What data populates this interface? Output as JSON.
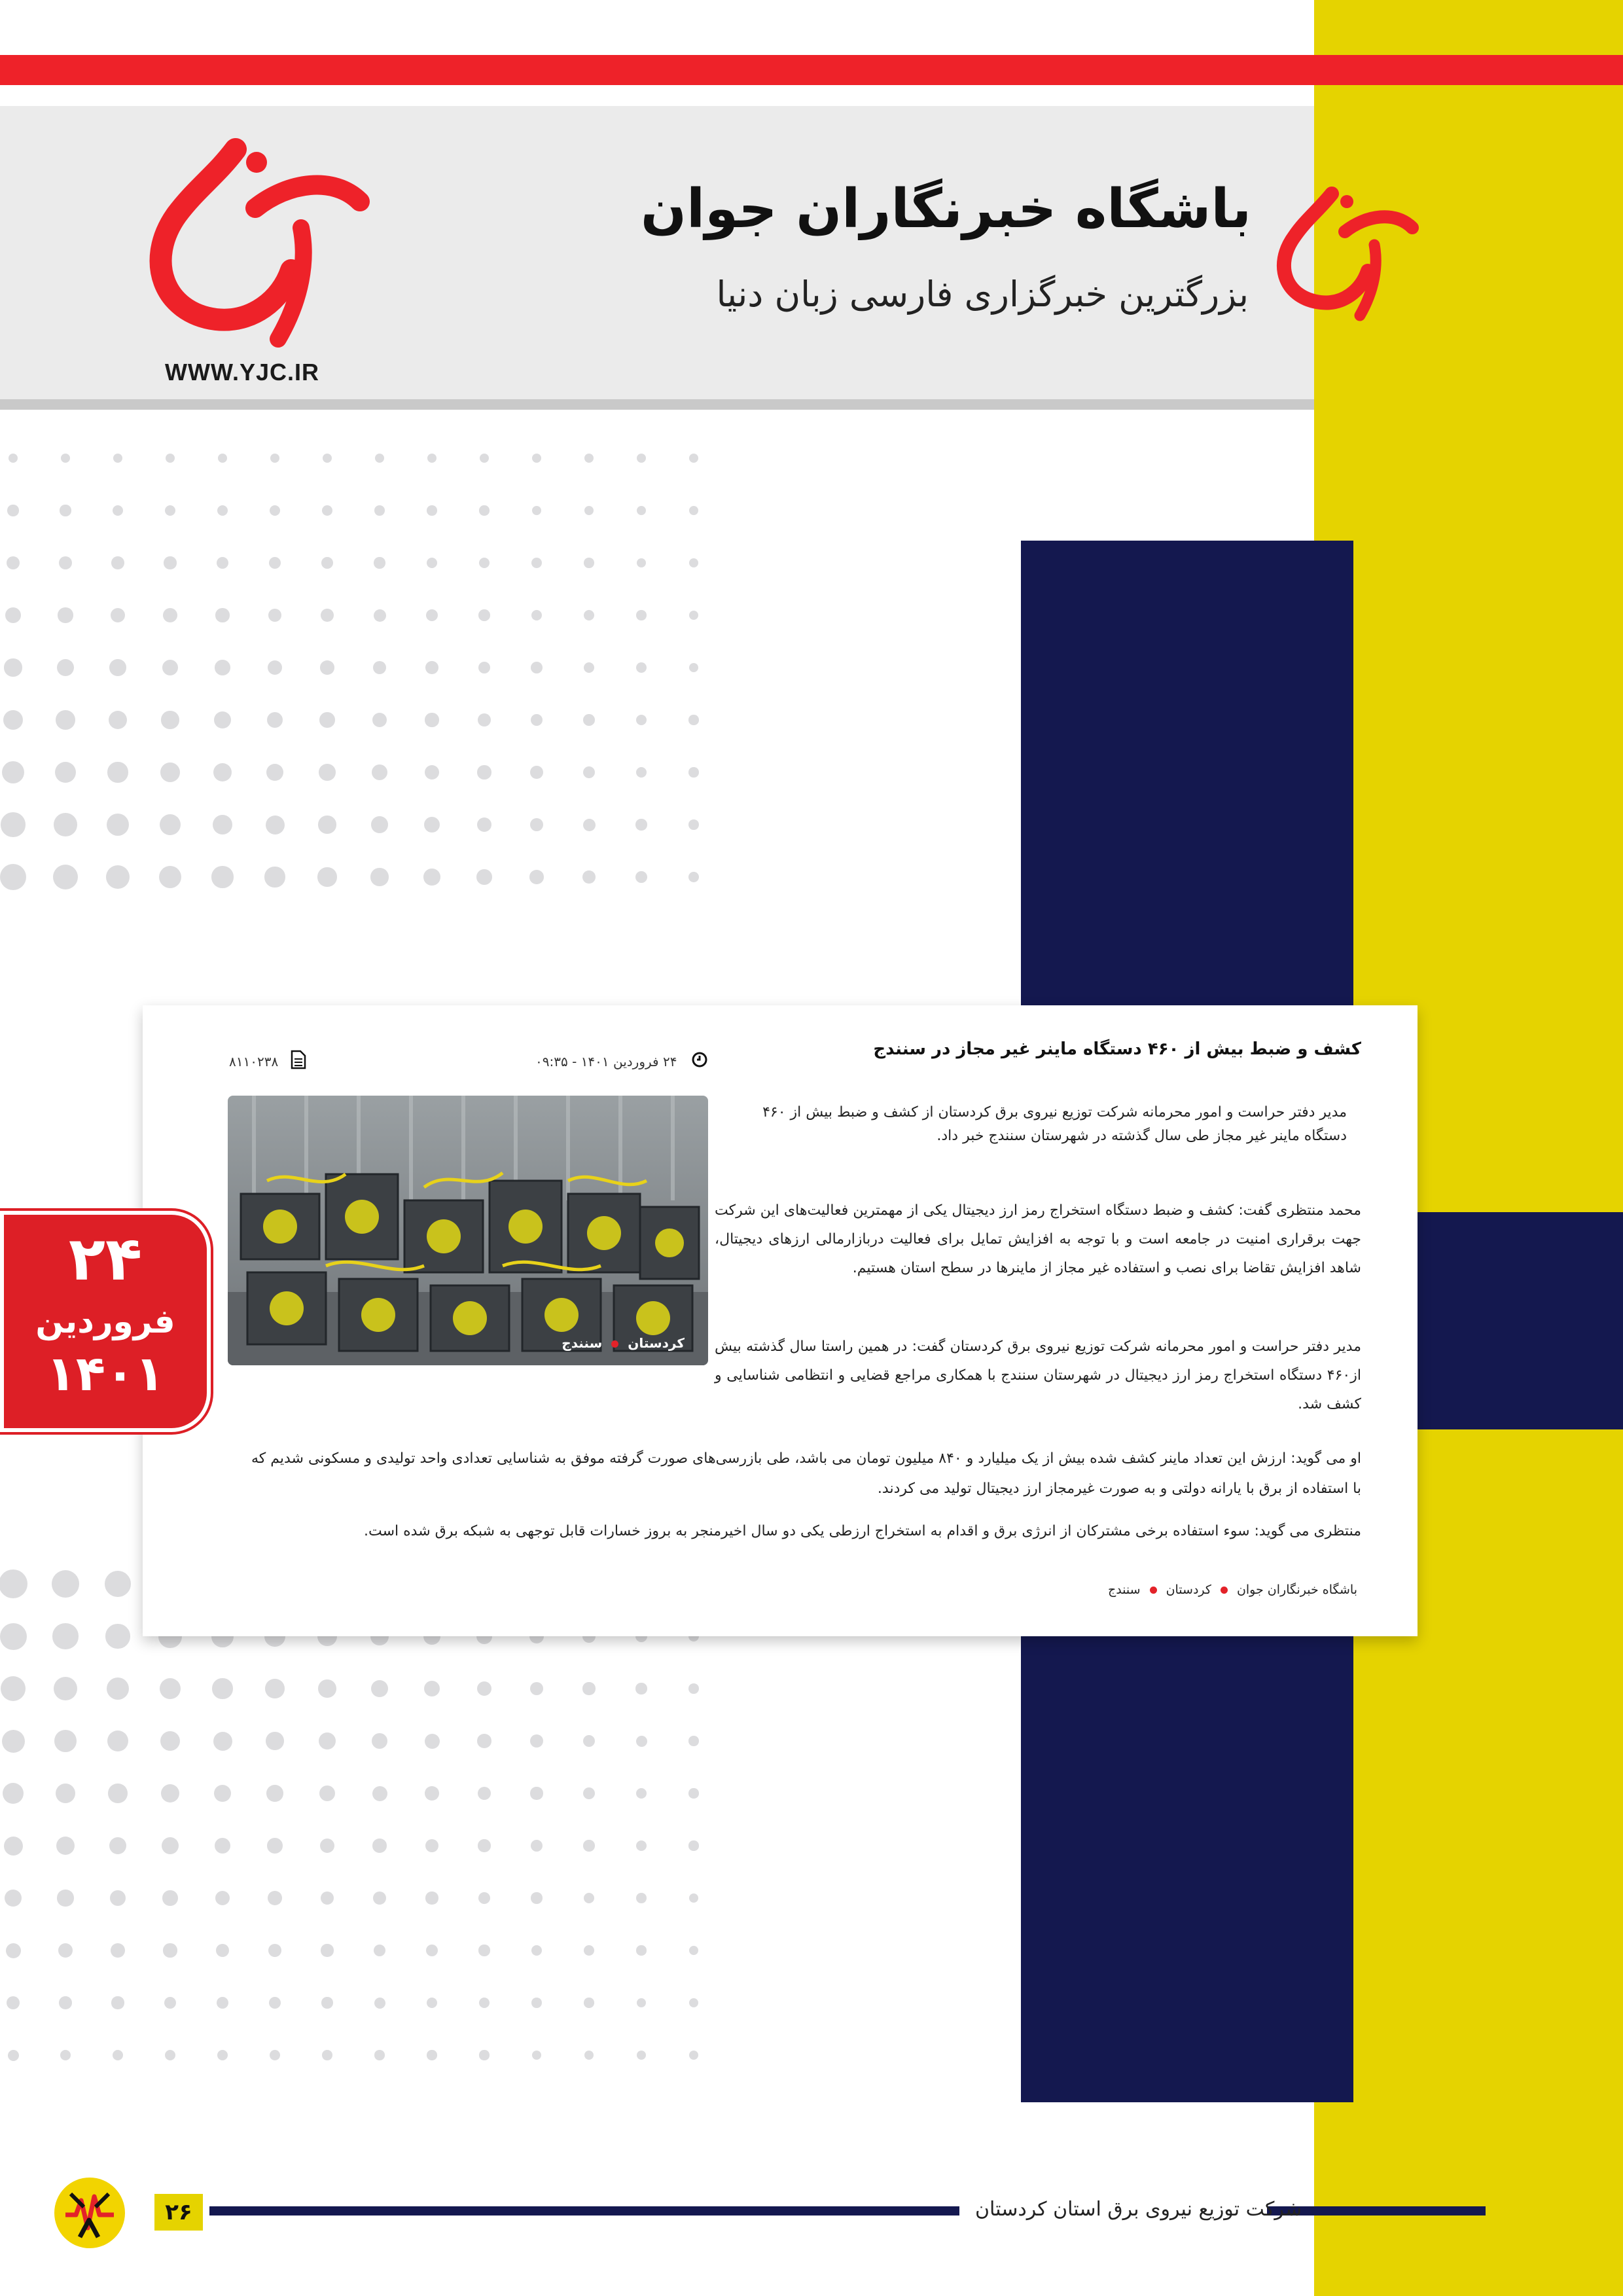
{
  "colors": {
    "red": "#ee2229",
    "yellow": "#e5d300",
    "navy": "#14184f",
    "header_gray": "#ebebeb"
  },
  "header": {
    "logo_icon": "yjc-logo",
    "site_url": "WWW.YJC.IR",
    "brand_title": "باشگاه خبرنگاران جوان",
    "brand_subtitle": "بزرگترین خبرگزاری فارسی زبان دنیا"
  },
  "date_badge": {
    "day": "۲۴",
    "month": "فروردین",
    "year": "۱۴۰۱"
  },
  "article": {
    "title": "کشف و ضبط بیش از ۴۶۰ دستگاه ماینر غیر مجاز در سنندج",
    "date_time": "۲۴ فروردین ۱۴۰۱ - ۰۹:۳۵",
    "news_id": "۸۱۱۰۲۳۸",
    "lead": "مدیر دفتر حراست و امور محرمانه شرکت توزیع نیروی برق کردستان از کشف و ضبط بیش از ۴۶۰ دستگاه ماینر غیر مجاز طی سال گذشته در شهرستان سنندج خبر داد.",
    "photo_tags": [
      "کردستان",
      "سنندج"
    ],
    "paragraphs": [
      "محمد منتظری گفت: کشف و ضبط دستگاه استخراج رمز ارز دیجیتال یکی از مهمترین فعالیت‌های این شرکت جهت برقراری امنیت در جامعه است و با توجه به افزایش تمایل برای فعالیت دربازارمالی ارزهای دیجیتال، شاهد افزایش تقاضا برای نصب و استفاده غیر مجاز از ماینرها در سطح استان هستیم.",
      "مدیر دفتر حراست و امور محرمانه شرکت توزیع نیروی برق کردستان گفت: در همین راستا سال گذشته بیش از۴۶۰ دستگاه استخراج رمز ارز دیجیتال در شهرستان سنندج با همکاری مراجع قضایی و انتظامی شناسایی و کشف شد.",
      "او می گوید: ارزش این تعداد ماینر کشف شده بیش از یک میلیارد و ۸۴۰ میلیون تومان می باشد، طی بازرسی‌های صورت گرفته موفق به شناسایی تعدادی واحد تولیدی و مسکونی شدیم که با استفاده از برق با یارانه دولتی و به صورت غیرمجاز ارز دیجیتال تولید می کردند.",
      "منتظری می گوید: سوء استفاده برخی مشترکان از انرژی برق و اقدام به استخراج ارزطی یکی دو سال اخیرمنجر به بروز خسارات قابل توجهی به شبکه برق شده است."
    ],
    "tags": [
      "باشگاه خبرنگاران جوان",
      "کردستان",
      "سنندج"
    ]
  },
  "footer": {
    "company": "شرکت توزیع نیروی برق استان کردستان",
    "page_number": "۲۶",
    "logo_icon": "power-distribution-logo"
  }
}
